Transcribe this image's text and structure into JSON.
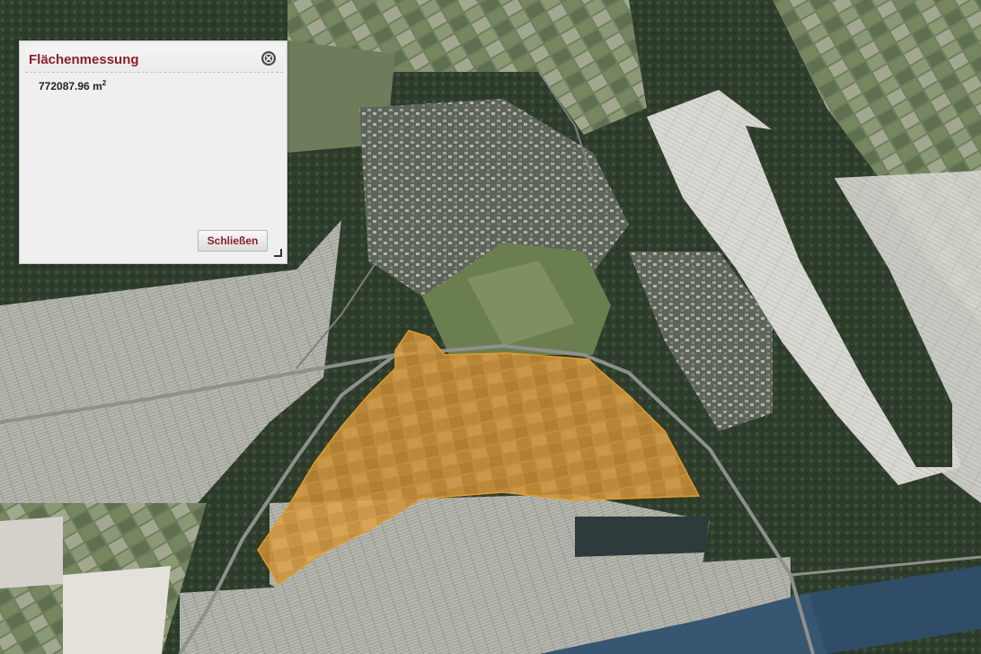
{
  "dialog": {
    "title": "Flächenmessung",
    "result_value": "772087.96",
    "result_unit": "m",
    "result_exponent": "2",
    "close_button_label": "Schließen"
  },
  "map": {
    "measured_area_color": "#e8a33a",
    "river_color": "#2f4d67"
  },
  "icons": {
    "dialog_close": "close-circle-icon",
    "resize": "resize-handle-icon"
  }
}
